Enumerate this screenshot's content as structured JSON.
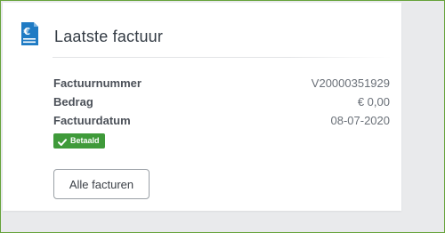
{
  "card": {
    "title": "Laatste factuur",
    "icon": "invoice-euro-icon",
    "accent_color": "#1f7bc4"
  },
  "details": [
    {
      "label": "Factuurnummer",
      "value": "V20000351929"
    },
    {
      "label": "Bedrag",
      "value": "€ 0,00"
    },
    {
      "label": "Factuurdatum",
      "value": "08-07-2020"
    }
  ],
  "status_badge": {
    "label": "Betaald",
    "icon": "check-icon",
    "color": "#3f9a3a"
  },
  "actions": {
    "all_invoices_label": "Alle facturen"
  }
}
